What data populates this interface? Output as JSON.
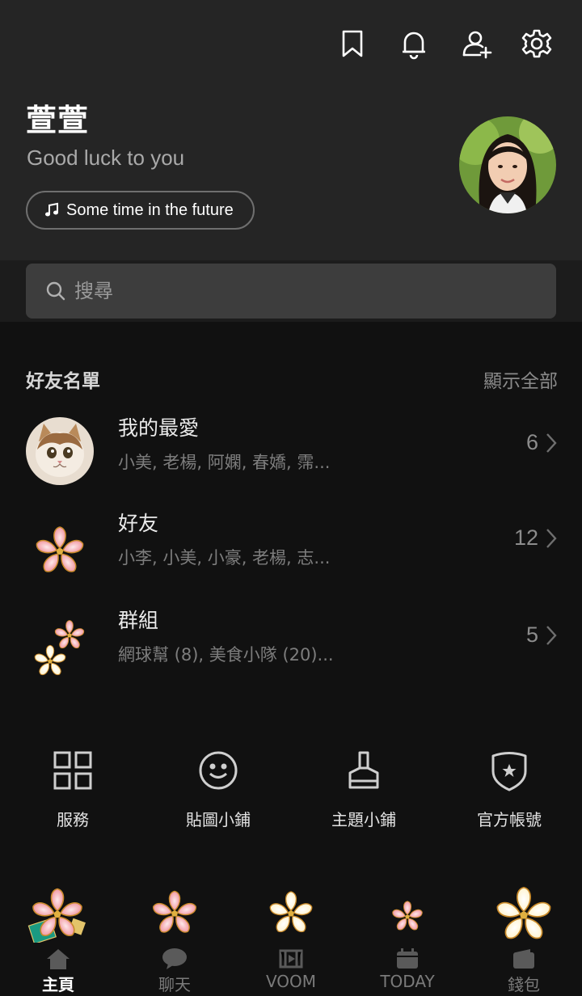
{
  "profile": {
    "name": "萱萱",
    "status": "Good luck to you",
    "music": "Some time in the future"
  },
  "search": {
    "placeholder": "搜尋"
  },
  "friends_section": {
    "title": "好友名單",
    "show_all": "顯示全部",
    "rows": [
      {
        "title": "我的最愛",
        "subtitle": "小美, 老楊, 阿嫻, 春嬌, 霈...",
        "count": "6"
      },
      {
        "title": "好友",
        "subtitle": "小李, 小美, 小豪, 老楊, 志...",
        "count": "12"
      },
      {
        "title": "群組",
        "subtitle": "網球幫 (8), 美食小隊 (20)...",
        "count": "5"
      }
    ]
  },
  "services": [
    {
      "label": "服務",
      "icon": "grid-icon"
    },
    {
      "label": "貼圖小鋪",
      "icon": "smiley-icon"
    },
    {
      "label": "主題小鋪",
      "icon": "brush-icon"
    },
    {
      "label": "官方帳號",
      "icon": "shield-star-icon"
    }
  ],
  "tabs": [
    {
      "label": "主頁",
      "icon": "home-icon",
      "active": true
    },
    {
      "label": "聊天",
      "icon": "chat-icon",
      "active": false
    },
    {
      "label": "VOOM",
      "icon": "voom-icon",
      "active": false
    },
    {
      "label": "TODAY",
      "icon": "calendar-icon",
      "active": false
    },
    {
      "label": "錢包",
      "icon": "wallet-icon",
      "active": false
    }
  ],
  "colors": {
    "header_bg": "#252525",
    "page_bg": "#111111",
    "search_bg": "#3d3d3d",
    "blossom_pink": "#f4a0a8",
    "blossom_cream": "#fff8e0"
  }
}
